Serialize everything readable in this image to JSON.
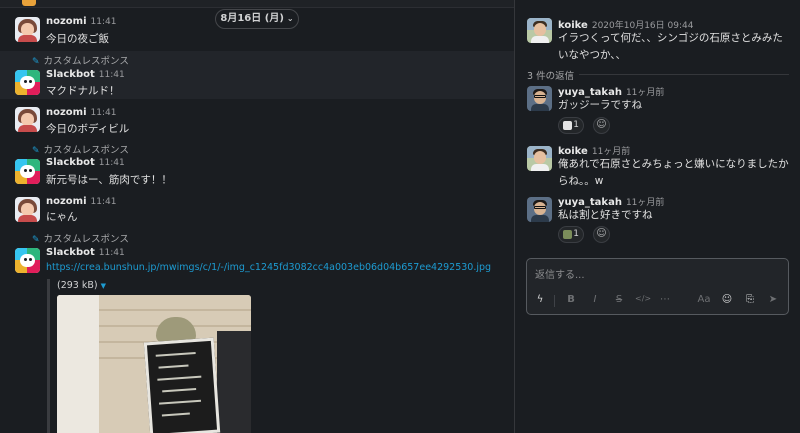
{
  "channel": {
    "date_divider": "8月16日 (月)",
    "messages": [
      {
        "user": "nozomi",
        "time": "11:41",
        "text": "今日の夜ご飯"
      },
      {
        "custom_label": "カスタムレスポンス",
        "user": "Slackbot",
        "time": "11:41",
        "text": "マクドナルド！"
      },
      {
        "user": "nozomi",
        "time": "11:41",
        "text": "今日のボディビル"
      },
      {
        "custom_label": "カスタムレスポンス",
        "user": "Slackbot",
        "time": "11:41",
        "text": "新元号はー、筋肉です！！"
      },
      {
        "user": "nozomi",
        "time": "11:41",
        "text": "にゃん"
      },
      {
        "custom_label": "カスタムレスポンス",
        "user": "Slackbot",
        "time": "11:41",
        "text": "https://crea.bunshun.jp/mwimgs/c/1/-/img_c1245fd3082cc4a003eb06d04b657ee4292530.jpg"
      }
    ],
    "attachment": {
      "size": "(293 kB)"
    }
  },
  "thread": {
    "parent": {
      "user": "koike",
      "time": "2020年10月16日 09:44",
      "text": "イラつくって何だ、、シンゴジの石原さとみみたいなやつか、、"
    },
    "reply_count": "3 件の返信",
    "replies": [
      {
        "user": "yuya_takah",
        "time": "11ヶ月前",
        "text": "ガッジーラですね",
        "reaction_count": "1"
      },
      {
        "user": "koike",
        "time": "11ヶ月前",
        "text": "俺あれで石原さとみちょっと嫌いになりましたからね。。w"
      },
      {
        "user": "yuya_takah",
        "time": "11ヶ月前",
        "text": "私は割と好きですね",
        "reaction_count": "1"
      }
    ],
    "composer": {
      "placeholder": "返信する...",
      "tools": {
        "bold": "B",
        "italic": "I",
        "strike": "S",
        "code": "</>",
        "more": "⋯",
        "font": "Aa"
      }
    }
  },
  "colors": {
    "background": "#1a1d21",
    "link": "#1d9bd1",
    "slackbot": [
      "#36c5f0",
      "#2eb67d",
      "#ecb22e",
      "#e01e5a"
    ]
  },
  "icons": [
    "pencil-icon",
    "chevron-down-icon",
    "add-reaction-icon",
    "shortcut-icon",
    "emoji-icon",
    "attach-icon",
    "send-icon"
  ]
}
